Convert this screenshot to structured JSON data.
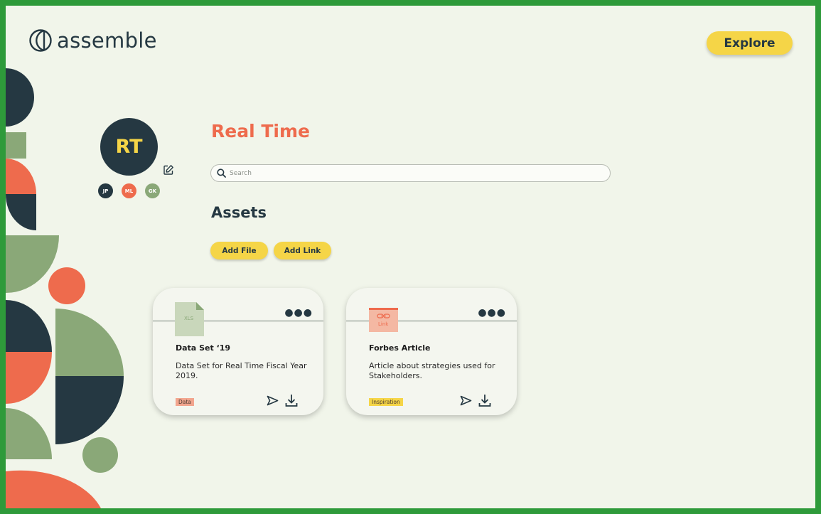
{
  "app": {
    "name": "assemble"
  },
  "header": {
    "explore_label": "Explore"
  },
  "profile": {
    "initials": "RT",
    "members": [
      {
        "initials": "JP",
        "color": "#253842"
      },
      {
        "initials": "ML",
        "color": "#ee6b4d"
      },
      {
        "initials": "GK",
        "color": "#8aa878"
      }
    ]
  },
  "main": {
    "title": "Real Time",
    "search": {
      "placeholder": "Search",
      "value": ""
    },
    "assets_heading": "Assets",
    "add_file_label": "Add File",
    "add_link_label": "Add Link"
  },
  "cards": [
    {
      "thumb_label": "XLS",
      "title": "Data Set ‘19",
      "description": "Data Set for Real Time Fiscal Year 2019.",
      "tag": "Data",
      "tag_color": "#f2a58e"
    },
    {
      "thumb_label": "Link",
      "title": "Forbes Article",
      "description": "Article about strategies used for Stakeholders.",
      "tag": "Inspiration",
      "tag_color": "#f5d547"
    }
  ],
  "colors": {
    "dark": "#253842",
    "coral": "#ee6b4d",
    "sage": "#8aa878",
    "yellow": "#f5d547",
    "background": "#f1f5ea"
  }
}
